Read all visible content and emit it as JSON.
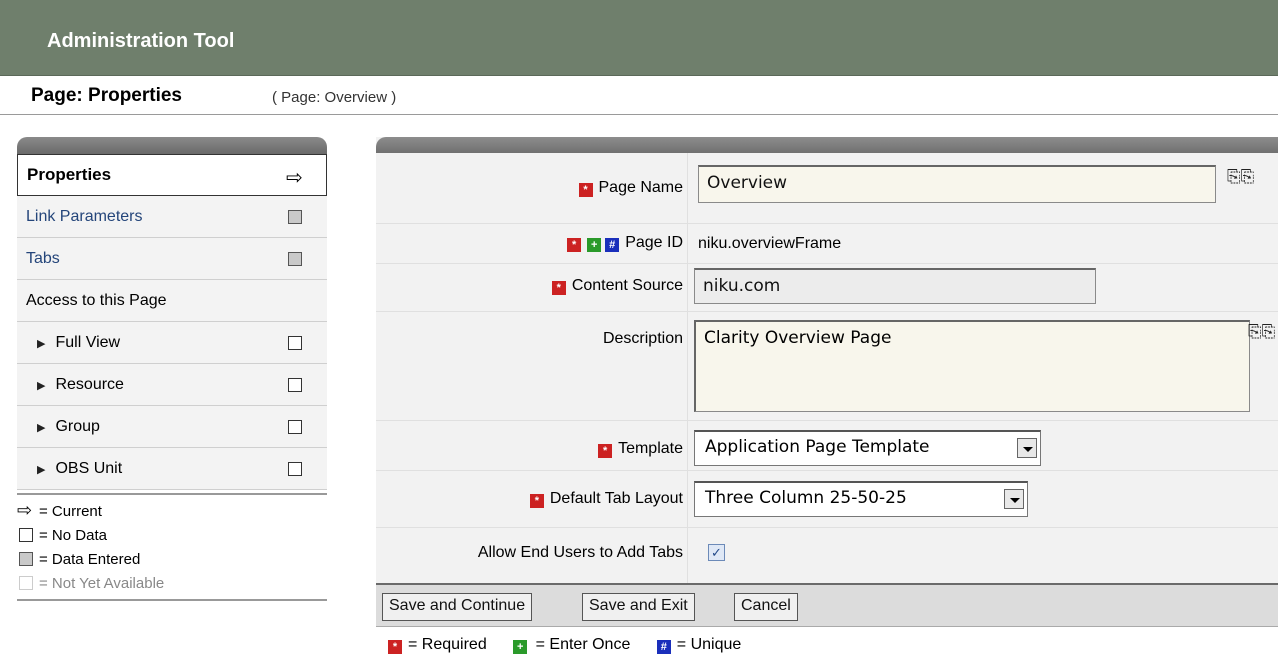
{
  "app": {
    "title": "Administration Tool"
  },
  "page": {
    "title": "Page: Properties",
    "subtitle": "( Page: Overview )"
  },
  "nav": {
    "items": [
      {
        "label": "Properties",
        "state": "current"
      },
      {
        "label": "Link Parameters",
        "state": "data-entered"
      },
      {
        "label": "Tabs",
        "state": "data-entered"
      },
      {
        "label": "Access to this Page",
        "state": "header"
      },
      {
        "label": "Full View",
        "state": "no-data"
      },
      {
        "label": "Resource",
        "state": "no-data"
      },
      {
        "label": "Group",
        "state": "no-data"
      },
      {
        "label": "OBS Unit",
        "state": "no-data"
      }
    ]
  },
  "legend": {
    "current": "= Current",
    "no_data": "= No Data",
    "data_entered": "= Data Entered",
    "not_available": "= Not Yet Available"
  },
  "form": {
    "page_name": {
      "label": "Page Name",
      "value": "Overview"
    },
    "page_id": {
      "label": "Page ID",
      "value": "niku.overviewFrame"
    },
    "content_source": {
      "label": "Content Source",
      "value": "niku.com"
    },
    "description": {
      "label": "Description",
      "value": "Clarity Overview Page"
    },
    "template": {
      "label": "Template",
      "value": "Application Page Template"
    },
    "default_tab_layout": {
      "label": "Default Tab Layout",
      "value": "Three Column 25-50-25"
    },
    "allow_add_tabs": {
      "label": "Allow End Users to Add Tabs",
      "checked": true
    }
  },
  "buttons": {
    "save_continue": "Save and Continue",
    "save_exit": "Save and Exit",
    "cancel": "Cancel"
  },
  "key": {
    "required": "= Required",
    "enter_once": "= Enter Once",
    "unique": "= Unique"
  },
  "colors": {
    "header_bg": "#6f7f6c",
    "required": "#cc2222",
    "enter_once": "#2a9a2a",
    "unique": "#1a2fbb"
  }
}
